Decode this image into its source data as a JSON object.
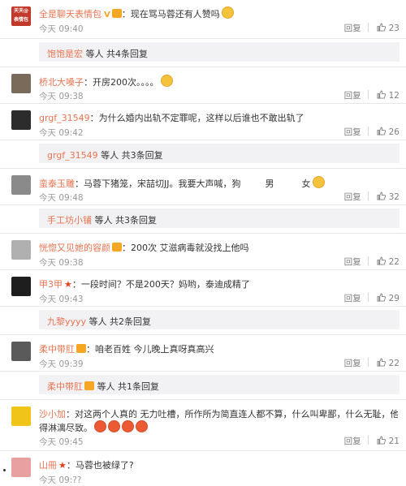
{
  "comments": [
    {
      "user": "全是聊天表情包",
      "badge": "V",
      "content": "：现在骂马蓉还有人赞吗",
      "time": "今天 09:40",
      "reply": "回复",
      "likes": "23",
      "avatar_color": "#c0392b",
      "avatar_text": "天天@ 表情包",
      "emoji": true
    },
    {
      "user": "桥北大嗓子",
      "content": "：开房200次。。。。",
      "time": "今天 09:38",
      "reply": "回复",
      "likes": "12",
      "avatar_color": "#7a6a5a",
      "emoji": true
    },
    {
      "user": "grgf_31549",
      "content": "：为什么婚内出轨不定罪呢，这样以后谁也不敢出轨了",
      "time": "今天 09:42",
      "reply": "回复",
      "likes": "26",
      "avatar_color": "#2c2c2c"
    },
    {
      "user": "蛮泰玉雕",
      "content": "：马蓉下猪笼，宋喆切JJ。我要大声喊，狗",
      "content2": "男",
      "content3": "女",
      "time": "今天 09:48",
      "reply": "回复",
      "likes": "32",
      "avatar_color": "#8a8a8a",
      "emoji": true
    },
    {
      "user": "恍惚又见她的容颜",
      "content": "：200次 艾滋病毒就没找上他吗",
      "time": "今天 09:38",
      "reply": "回复",
      "likes": "22",
      "avatar_color": "#b0b0b0",
      "member": true
    },
    {
      "user": "甲3甲",
      "content": "：一段时间？不是200天？妈哟，泰迪成精了",
      "time": "今天 09:43",
      "reply": "回复",
      "likes": "29",
      "avatar_color": "#1e1e1e",
      "star": true
    },
    {
      "user": "柔中带肛",
      "content": "：咱老百姓 今儿晚上真呀真高兴",
      "time": "今天 09:39",
      "reply": "回复",
      "likes": "22",
      "avatar_color": "#5a5a5a",
      "member": true
    },
    {
      "user": "沙小加",
      "content": "：对这两个人真的 无力吐槽，所作所为简直连人都不算，什么叫卑鄙，什么无耻，他们表现",
      "content_line2": "得淋漓尽致。",
      "time": "今天 09:45",
      "reply": "回复",
      "likes": "21",
      "avatar_color": "#f0c419"
    },
    {
      "user": "山冊",
      "content": "：马蓉也被绿了?",
      "time": "今天 09:??",
      "reply": "",
      "likes": "",
      "avatar_color": "#e8a0a0",
      "star": true
    }
  ],
  "subreplies": [
    {
      "name": "饱饱是宏",
      "suffix": " 等人 共4条回复"
    },
    {
      "name": "grgf_31549",
      "suffix": " 等人 共3条回复"
    },
    {
      "name": "手工坊小铺",
      "suffix": " 等人 共3条回复"
    },
    {
      "name": "九黎yyyy",
      "suffix": " 等人 共2条回复"
    },
    {
      "name": "柔中带肛",
      "suffix": " 等人 共1条回复"
    }
  ]
}
